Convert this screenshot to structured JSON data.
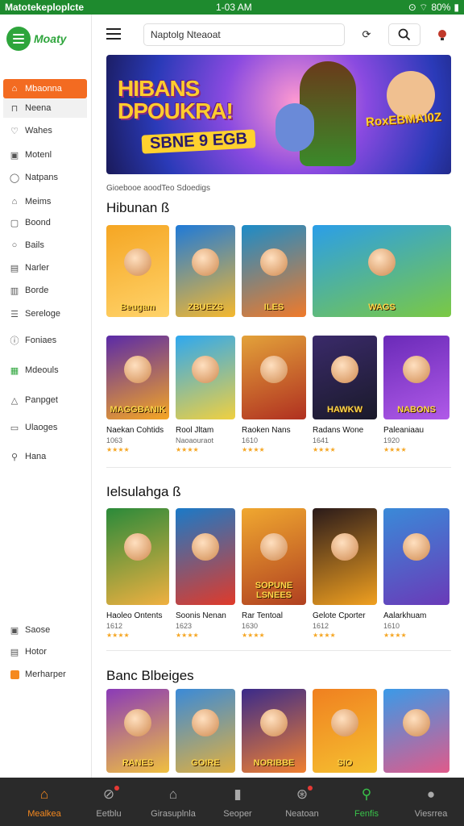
{
  "status_bar": {
    "left": "Matotekeploplcte",
    "time": "1-03 AM",
    "battery": "80%"
  },
  "app": {
    "logo_text": "Moaty"
  },
  "sidebar": {
    "items": [
      {
        "label": "Mbaonna",
        "icon": "home-icon"
      },
      {
        "label": "Neena",
        "icon": "bookmark-icon"
      },
      {
        "label": "Wahes",
        "icon": "heart-icon"
      },
      {
        "label": "Motenl",
        "icon": "calendar-icon"
      },
      {
        "label": "Natpans",
        "icon": "chat-icon"
      },
      {
        "label": "Meims",
        "icon": "tag-icon"
      },
      {
        "label": "Boond",
        "icon": "box-icon"
      },
      {
        "label": "Bails",
        "icon": "circle-icon"
      },
      {
        "label": "Narler",
        "icon": "document-icon"
      },
      {
        "label": "Borde",
        "icon": "clipboard-icon"
      },
      {
        "label": "Sereloge",
        "icon": "list-icon"
      },
      {
        "label": "Foniaes",
        "icon": "info-icon"
      },
      {
        "label": "Mdeouls",
        "icon": "grid-icon"
      },
      {
        "label": "Panpget",
        "icon": "triangle-icon"
      },
      {
        "label": "Ulaoges",
        "icon": "folder-icon"
      },
      {
        "label": "Hana",
        "icon": "user-icon"
      },
      {
        "label": "Saose",
        "icon": "settings-icon"
      },
      {
        "label": "Hotor",
        "icon": "help-icon"
      },
      {
        "label": "Merharper",
        "icon": "star-icon"
      }
    ]
  },
  "topbar": {
    "search_value": "Naptolg Nteaoat"
  },
  "banner": {
    "title_line1": "HIBANS",
    "title_line2": "DPOUKRA!",
    "sub": "SBNE 9 EGB",
    "right_text": "RoxEBMAI0Z",
    "caption": "Gioebooe aoodTeo Sdoedigs"
  },
  "sections": [
    {
      "title": "Hibunan ß"
    },
    {
      "title": "Ielsulahga ß"
    },
    {
      "title": "Banc Blbeiges"
    }
  ],
  "row1": [
    {
      "label": "Beugam",
      "c1": "#f5a623",
      "c2": "#ffd36a"
    },
    {
      "label": "ZBUEZS",
      "c1": "#1f7ad8",
      "c2": "#f5b82e"
    },
    {
      "label": "ILES",
      "c1": "#1b8cc9",
      "c2": "#f07a2a"
    },
    {
      "label": "WAGS",
      "c1": "#2b9ee8",
      "c2": "#7bc943"
    }
  ],
  "row2": [
    {
      "label": "MAGGBANIK",
      "c1": "#5a2aa8",
      "c2": "#f5a623",
      "title": "Naekan Cohtids",
      "sub": "1063",
      "stars": "★★★★"
    },
    {
      "label": "",
      "c1": "#2ea8f0",
      "c2": "#f0d040",
      "title": "Rool Jltam",
      "sub": "Naoaouraot",
      "stars": "★★★★"
    },
    {
      "label": "",
      "c1": "#e3a23a",
      "c2": "#b03020",
      "title": "Raoken Nans",
      "sub": "1610",
      "stars": "★★★★"
    },
    {
      "label": "HAWKW",
      "c1": "#3a2a6a",
      "c2": "#1a1a2a",
      "title": "Radans Wone",
      "sub": "1641",
      "stars": "★★★★"
    },
    {
      "label": "NABONS",
      "c1": "#6a2ab8",
      "c2": "#b05ae8",
      "title": "Paleaniaau",
      "sub": "1920",
      "stars": "★★★★"
    }
  ],
  "row3": [
    {
      "label": "",
      "c1": "#2a8a3a",
      "c2": "#f0b040",
      "title": "Haoleo Ontents",
      "sub": "1612",
      "stars": "★★★★"
    },
    {
      "label": "",
      "c1": "#1a7ac8",
      "c2": "#e03a2a",
      "title": "Soonis Nenan",
      "sub": "1623",
      "stars": "★★★★"
    },
    {
      "label": "SOPUNE LSNEES",
      "c1": "#f0a830",
      "c2": "#b04020",
      "title": "Rar Tentoal",
      "sub": "1630",
      "stars": "★★★★"
    },
    {
      "label": "",
      "c1": "#2a1a1a",
      "c2": "#f0a020",
      "title": "Gelote Cporter",
      "sub": "1612",
      "stars": "★★★★"
    },
    {
      "label": "",
      "c1": "#3a8ad8",
      "c2": "#6a3ab8",
      "title": "Aalarkhuam",
      "sub": "1610",
      "stars": "★★★★"
    }
  ],
  "row4": [
    {
      "label": "RANES",
      "c1": "#8a3ab8",
      "c2": "#f0c040"
    },
    {
      "label": "GOIRE",
      "c1": "#3a8ad8",
      "c2": "#e0b040"
    },
    {
      "label": "NORIBBE",
      "c1": "#3a2a8a",
      "c2": "#f08030"
    },
    {
      "label": "SIO",
      "c1": "#f08020",
      "c2": "#f5c030"
    },
    {
      "label": "",
      "c1": "#3a9ae8",
      "c2": "#e05a8a"
    }
  ],
  "bottom_nav": [
    {
      "label": "Mealkea",
      "icon": "home-icon"
    },
    {
      "label": "Eetblu",
      "icon": "compass-icon"
    },
    {
      "label": "Girasuplnla",
      "icon": "games-icon"
    },
    {
      "label": "Seoper",
      "icon": "store-icon"
    },
    {
      "label": "Neatoan",
      "icon": "controller-icon"
    },
    {
      "label": "Fenfis",
      "icon": "search-icon"
    },
    {
      "label": "Viesrrea",
      "icon": "user-icon"
    }
  ]
}
